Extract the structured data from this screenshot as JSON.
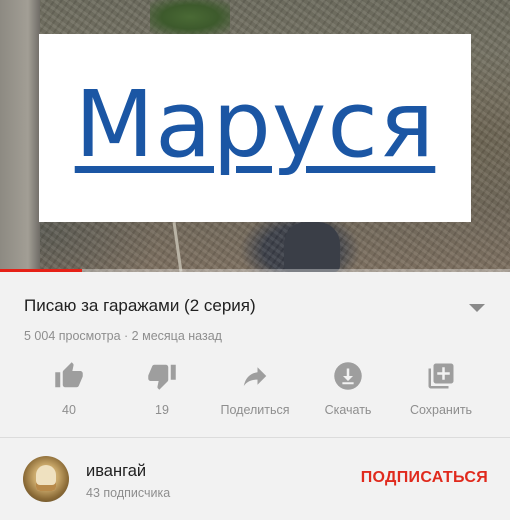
{
  "video": {
    "overlay_title": "Маруся",
    "progress": 0.16
  },
  "info": {
    "title": "Писаю за гаражами (2 серия)",
    "meta": "5 004 просмотра · 2 месяца назад"
  },
  "actions": [
    {
      "icon": "thumbs-up-icon",
      "label": "40"
    },
    {
      "icon": "thumbs-down-icon",
      "label": "19"
    },
    {
      "icon": "share-icon",
      "label": "Поделиться"
    },
    {
      "icon": "download-icon",
      "label": "Скачать"
    },
    {
      "icon": "add-to-playlist-icon",
      "label": "Сохранить"
    }
  ],
  "channel": {
    "name": "ивангай",
    "subscribers": "43 подписчика",
    "subscribe_label": "ПОДПИСАТЬСЯ"
  },
  "colors": {
    "accent_red": "#e02a1d",
    "overlay_blue": "#1b56a4",
    "icon_gray": "#9e9e9e"
  }
}
